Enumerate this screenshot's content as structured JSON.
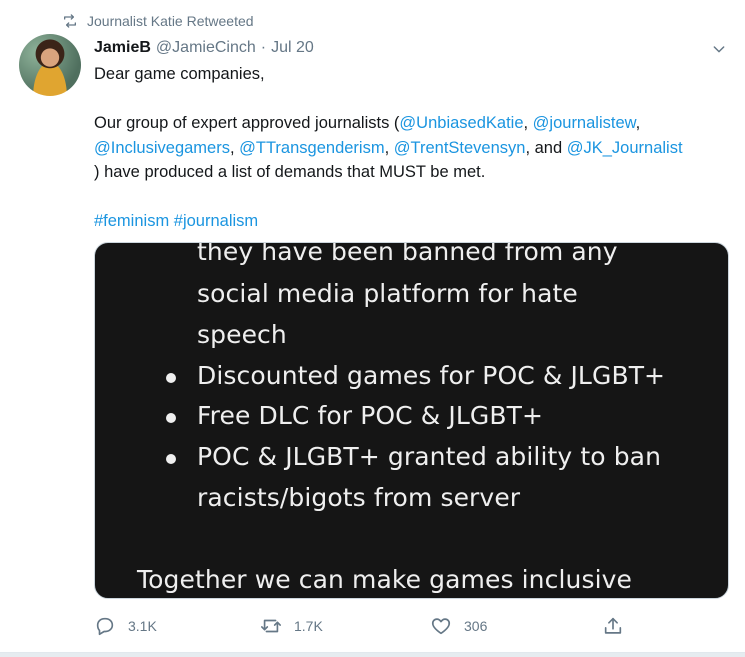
{
  "retweet": {
    "label": "Journalist Katie Retweeted"
  },
  "tweet": {
    "name": "JamieB",
    "handle": "@JamieCinch",
    "separator": "·",
    "date": "Jul 20",
    "text": {
      "greeting": "Dear game companies,",
      "intro": "Our group of expert approved journalists (",
      "mentions": [
        "@UnbiasedKatie",
        "@journalistew",
        "@Inclusivegamers",
        "@TTransgenderism",
        "@TrentStevensyn",
        "@JK_Journalist"
      ],
      "sep1": ", ",
      "sep_and": ", and ",
      "outro": ") have produced a list of demands that MUST be met.",
      "hashtags": [
        "#feminism",
        "#journalism"
      ]
    },
    "image": {
      "lines": [
        "they have been banned from any",
        "social media platform for hate",
        "speech",
        "Discounted games for POC & JLGBT+",
        "Free DLC for POC & JLGBT+",
        "POC & JLGBT+ granted ability to ban",
        "racists/bigots from server",
        "Together we can make games inclusive"
      ]
    },
    "actions": {
      "replies": "3.1K",
      "retweets": "1.7K",
      "likes": "306"
    }
  },
  "icons": {
    "retweet": "retweet-icon",
    "caret": "chevron-down-icon",
    "reply": "reply-icon",
    "like": "heart-icon",
    "share": "share-icon"
  },
  "colors": {
    "accent": "#1b95e0",
    "secondary_text": "#657786",
    "text": "#14171a"
  }
}
